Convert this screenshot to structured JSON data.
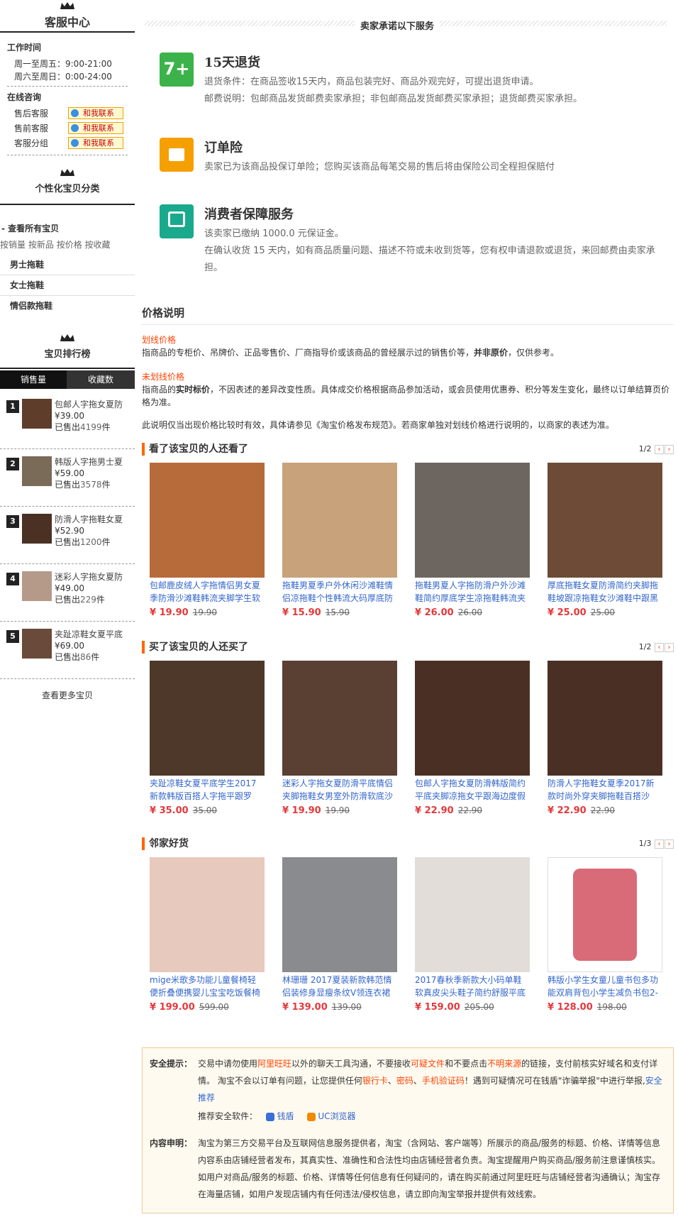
{
  "left": {
    "cs_title": "客服中心",
    "work_time_label": "工作时间",
    "work_time_1": "周一至周五：9:00-21:00",
    "work_time_2": "周六至周日：0:00-24:00",
    "online_label": "在线咨询",
    "cs_rows": [
      {
        "label": "售后客服",
        "btn": "和我联系"
      },
      {
        "label": "售前客服",
        "btn": "和我联系"
      },
      {
        "label": "客服分组",
        "btn": "和我联系"
      }
    ],
    "cat_title": "个性化宝贝分类",
    "all_items": "查看所有宝贝",
    "sorts": [
      "按销量",
      "按新品",
      "按价格",
      "按收藏"
    ],
    "categories": [
      "男士拖鞋",
      "女士拖鞋",
      "情侣款拖鞋"
    ],
    "rank_title": "宝贝排行榜",
    "rank_tabs": [
      "销售量",
      "收藏数"
    ],
    "rank_items": [
      {
        "no": "1",
        "title": "包邮人字拖女夏防",
        "price": "¥39.00",
        "sold_prefix": "已售出",
        "sold": "4199",
        "sold_suffix": "件"
      },
      {
        "no": "2",
        "title": "韩版人字拖男士夏",
        "price": "¥59.00",
        "sold_prefix": "已售出",
        "sold": "3578",
        "sold_suffix": "件"
      },
      {
        "no": "3",
        "title": "防滑人字拖鞋女夏",
        "price": "¥52.90",
        "sold_prefix": "已售出",
        "sold": "1200",
        "sold_suffix": "件"
      },
      {
        "no": "4",
        "title": "迷彩人字拖女夏防",
        "price": "¥49.00",
        "sold_prefix": "已售出",
        "sold": "229",
        "sold_suffix": "件"
      },
      {
        "no": "5",
        "title": "夹趾凉鞋女夏平底",
        "price": "¥69.00",
        "sold_prefix": "已售出",
        "sold": "86",
        "sold_suffix": "件"
      }
    ],
    "more": "查看更多宝贝"
  },
  "promise": {
    "title": "卖家承诺以下服务",
    "services": [
      {
        "title": "15天退货",
        "lines": [
          "退货条件：在商品签收15天内，商品包装完好、商品外观完好，可提出退货申请。",
          "邮费说明：包邮商品发货邮费卖家承担；非包邮商品发货邮费买家承担；退货邮费买家承担。"
        ],
        "color": "#3cb34a"
      },
      {
        "title": "订单险",
        "lines": [
          "卖家已为该商品投保订单险；您购买该商品每笔交易的售后将由保险公司全程担保赔付"
        ],
        "color": "#f5a000"
      },
      {
        "title": "消费者保障服务",
        "lines": [
          "该卖家已缴纳 1000.0 元保证金。",
          "在确认收货 15 天内，如有商品质量问题、描述不符或未收到货等，您有权申请退款或退货，来回邮费由卖家承担。"
        ],
        "color": "#19a98c"
      }
    ]
  },
  "price_note": {
    "title": "价格说明",
    "h1": "划线价格",
    "p1a": "指商品的专柜价、吊牌价、正品零售价、厂商指导价或该商品的曾经展示过的销售价等，",
    "p1b": "并非原价",
    "p1c": "，仅供参考。",
    "h2": "未划线价格",
    "p2a": "指商品的",
    "p2b": "实时标价",
    "p2c": "，不因表述的差异改变性质。具体成交价格根据商品参加活动，或会员使用优惠券、积分等发生变化，最终以订单结算页价格为准。",
    "p3": "此说明仅当出现价格比较时有效，具体请参见《淘宝价格发布规范》。若商家单独对划线价格进行说明的，以商家的表述为准。"
  },
  "sections": [
    {
      "title": "看了该宝贝的人还看了",
      "page": "1/2",
      "items": [
        {
          "name": "包邮鹿皮绒人字拖情侣男女夏季防滑沙滩鞋韩流夹脚学生软",
          "price": "¥ 19.90",
          "old": "19.90",
          "img": "#b76a3a"
        },
        {
          "name": "拖鞋男夏季户外休闲沙滩鞋情侣凉拖鞋个性韩流大码厚底防",
          "price": "¥ 15.90",
          "old": "15.90",
          "img": "#c7a27a"
        },
        {
          "name": "拖鞋男夏人字拖防滑户外沙滩鞋简约厚底学生凉拖鞋韩流夹",
          "price": "¥ 26.00",
          "old": "26.00",
          "img": "#6d6660"
        },
        {
          "name": "厚底拖鞋女夏防滑简约夹脚拖鞋坡跟凉拖鞋女沙滩鞋中跟黑",
          "price": "¥ 25.00",
          "old": "25.00",
          "img": "#6e4b36"
        }
      ]
    },
    {
      "title": "买了该宝贝的人还买了",
      "page": "1/2",
      "items": [
        {
          "name": "夹趾凉鞋女夏平底学生2017新款韩版百搭人字拖平跟罗",
          "price": "¥ 35.00",
          "old": "35.00",
          "img": "#4d3829"
        },
        {
          "name": "迷彩人字拖女夏防滑平底情侣夹脚拖鞋女男室外防滑软底沙",
          "price": "¥ 19.90",
          "old": "19.90",
          "img": "#5a3f33"
        },
        {
          "name": "包邮人字拖女夏防滑韩版简约平底夹脚凉拖女平跟海边度假",
          "price": "¥ 22.90",
          "old": "22.90",
          "img": "#4a3024"
        },
        {
          "name": "防滑人字拖鞋女夏季2017新款时尚外穿夹脚拖鞋百搭沙",
          "price": "¥ 22.90",
          "old": "22.90",
          "img": "#4a3024"
        }
      ]
    },
    {
      "title": "邻家好货",
      "page": "1/3",
      "items": [
        {
          "name": "mige米歌多功能儿童餐椅轻便折叠便携婴儿宝宝吃饭餐椅幼",
          "price": "¥ 199.00",
          "old": "599.00",
          "img": "#e7c9bd"
        },
        {
          "name": "林珊珊 2017夏装新款韩范情侣装修身显瘦条纹V领连衣裙",
          "price": "¥ 139.00",
          "old": "139.00",
          "img": "#8a8b8f"
        },
        {
          "name": "2017春秋季新款大小码单鞋软真皮尖头鞋子简约舒服平底小",
          "price": "¥ 159.00",
          "old": "205.00",
          "img": "#e2ddd8"
        },
        {
          "name": "韩版小学生女童儿童书包多功能双肩背包小学生减负书包2-",
          "price": "¥ 128.00",
          "old": "198.00",
          "img": "#d96b78"
        }
      ]
    }
  ],
  "notice": {
    "safe_label": "安全提示：",
    "s1": "交易中请勿使用",
    "s1r": "阿里旺旺",
    "s2": "以外的聊天工具沟通，不要接收",
    "s2r": "可疑文件",
    "s3": "和不要点击",
    "s3r": "不明来源",
    "s4": "的链接，支付前核实好域名和支付详情。 淘宝不会以订单有问题，让您提供任何",
    "s4r1": "银行卡",
    "sep1": "、",
    "s4r2": "密码",
    "sep2": "、",
    "s4r3": "手机验证码",
    "s5": "！遇到可疑情况可在钱盾\"诈骗举报\"中进行举报,",
    "s5b": "安全推荐",
    "rec_label": "推荐安全软件：",
    "rec1": "钱盾",
    "rec2": "UC浏览器",
    "content_label": "内容申明：",
    "content": "淘宝为第三方交易平台及互联网信息服务提供者，淘宝（含网站、客户端等）所展示的商品/服务的标题、价格、详情等信息内容系由店铺经营者发布，其真实性、准确性和合法性均由店铺经营者负责。淘宝提醒用户购买商品/服务前注意谨慎核实。如用户对商品/服务的标题、价格、详情等任何信息有任何疑问的，请在购买前通过阿里旺旺与店铺经营者沟通确认；淘宝存在海量店铺，如用户发现店铺内有任何违法/侵权信息，请立即向淘宝举报并提供有效线索。"
  }
}
